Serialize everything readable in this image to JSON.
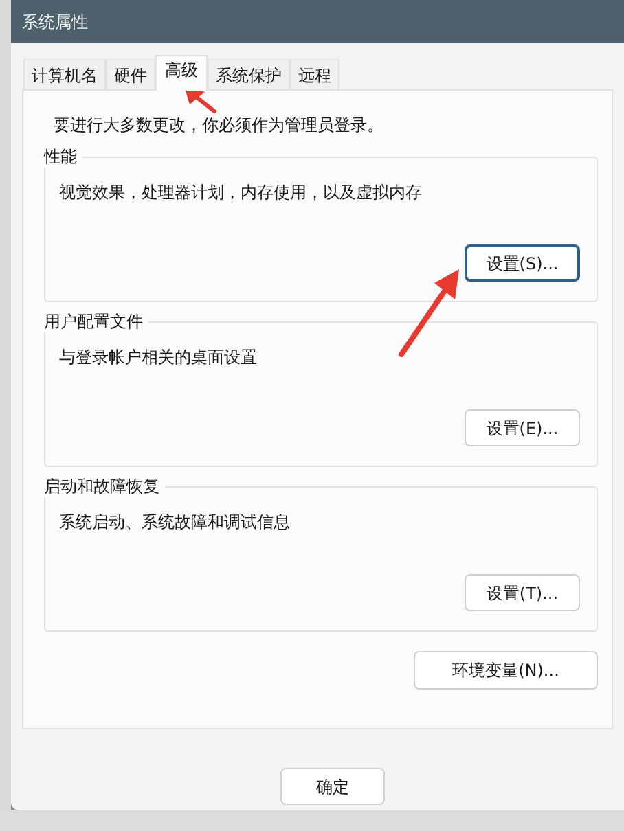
{
  "window": {
    "title": "系统属性"
  },
  "tabs": [
    {
      "label": "计算机名",
      "selected": false
    },
    {
      "label": "硬件",
      "selected": false
    },
    {
      "label": "高级",
      "selected": true
    },
    {
      "label": "系统保护",
      "selected": false
    },
    {
      "label": "远程",
      "selected": false
    }
  ],
  "notice": "要进行大多数更改，你必须作为管理员登录。",
  "groups": [
    {
      "title": "性能",
      "description": "视觉效果，处理器计划，内存使用，以及虚拟内存",
      "button": "设置(S)...",
      "focused": true
    },
    {
      "title": "用户配置文件",
      "description": "与登录帐户相关的桌面设置",
      "button": "设置(E)...",
      "focused": false
    },
    {
      "title": "启动和故障恢复",
      "description": "系统启动、系统故障和调试信息",
      "button": "设置(T)...",
      "focused": false
    }
  ],
  "env_button": "环境变量(N)...",
  "footer_buttons": [
    "确定"
  ]
}
